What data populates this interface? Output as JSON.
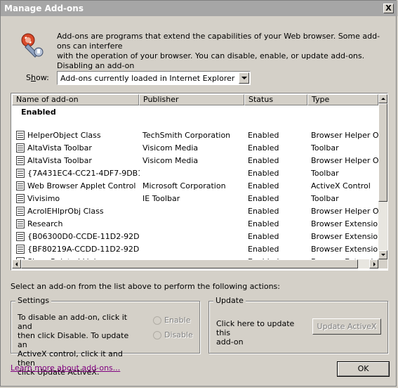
{
  "window": {
    "title": "Manage Add-ons",
    "close_symbol": "X"
  },
  "intro": {
    "text": "Add-ons are programs that extend the capabilities of your Web browser. Some add-ons can interfere\nwith the operation of your browser. You can disable, enable, or update add-ons. Disabling an add-on\nmight prevent some Web pages from working."
  },
  "show": {
    "label_prefix": "S",
    "label_accel": "h",
    "label_suffix": "ow:",
    "selected": "Add-ons currently loaded in Internet Explorer"
  },
  "list": {
    "columns": [
      "Name of add-on",
      "Publisher",
      "Status",
      "Type"
    ],
    "group": "Enabled",
    "rows": [
      {
        "name": "HelperObject Class",
        "publisher": "TechSmith Corporation",
        "status": "Enabled",
        "type": "Browser Helper Object"
      },
      {
        "name": "AltaVista Toolbar",
        "publisher": "Visicom Media",
        "status": "Enabled",
        "type": "Toolbar"
      },
      {
        "name": "AltaVista Toolbar",
        "publisher": "Visicom Media",
        "status": "Enabled",
        "type": "Browser Helper Object"
      },
      {
        "name": "{7A431EC4-CC21-4DF7-9DB1...",
        "publisher": "",
        "status": "Enabled",
        "type": "Toolbar"
      },
      {
        "name": "Web Browser Applet Control",
        "publisher": "Microsoft Corporation",
        "status": "Enabled",
        "type": "ActiveX Control"
      },
      {
        "name": "Vivisimo",
        "publisher": "IE Toolbar",
        "status": "Enabled",
        "type": "Toolbar"
      },
      {
        "name": "AcroIEHlprObj Class",
        "publisher": "",
        "status": "Enabled",
        "type": "Browser Helper Object"
      },
      {
        "name": "Research",
        "publisher": "",
        "status": "Enabled",
        "type": "Browser Extension"
      },
      {
        "name": "{B06300D0-CCDE-11D2-92D3...",
        "publisher": "",
        "status": "Enabled",
        "type": "Browser Extension"
      },
      {
        "name": "{BF80219A-CCDD-11D2-92D3...",
        "publisher": "",
        "status": "Enabled",
        "type": "Browser Extension"
      },
      {
        "name": "Show Related Links",
        "publisher": "",
        "status": "Enabled",
        "type": "Browser Extension"
      }
    ]
  },
  "instructions": "Select an add-on from the list above to perform the following actions:",
  "settings": {
    "title": "Settings",
    "text": "To disable an add-on, click it and\nthen click Disable. To update an\nActiveX control, click it and then\nclick Update ActiveX.",
    "enable_label": "Enable",
    "disable_label": "Disable"
  },
  "update": {
    "title": "Update",
    "text": "Click here to update this\nadd-on",
    "button": "Update ActiveX"
  },
  "footer": {
    "link": "Learn more about add-ons...",
    "ok": "OK"
  }
}
